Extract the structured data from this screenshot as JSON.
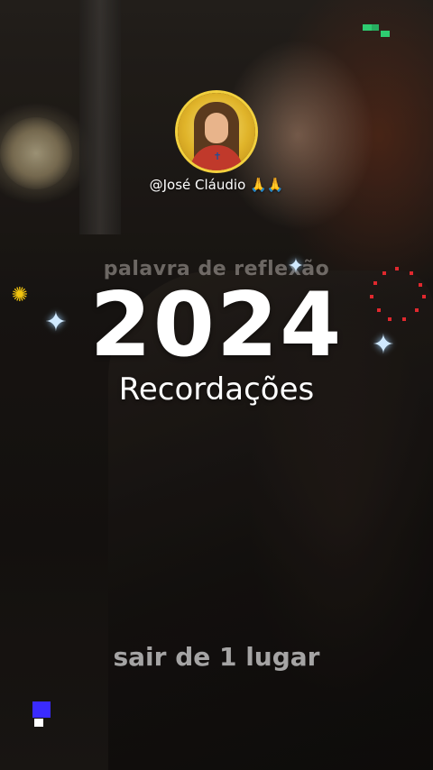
{
  "profile": {
    "username": "@José Cláudio 🙏🙏",
    "avatar_badge": "✝"
  },
  "watermark_text": "palavra de reflexão",
  "headline": {
    "year": "2024",
    "subtitle": "Recordações"
  },
  "caption": "sair de 1 lugar",
  "decorations": {
    "sparkle_icon": "sparkle-icon",
    "flower_icon": "flower-icon",
    "accent_green": "#2ecc71",
    "accent_blue": "#3a2bff",
    "accent_red": "#e0282e",
    "accent_gold": "#f1c40f"
  }
}
